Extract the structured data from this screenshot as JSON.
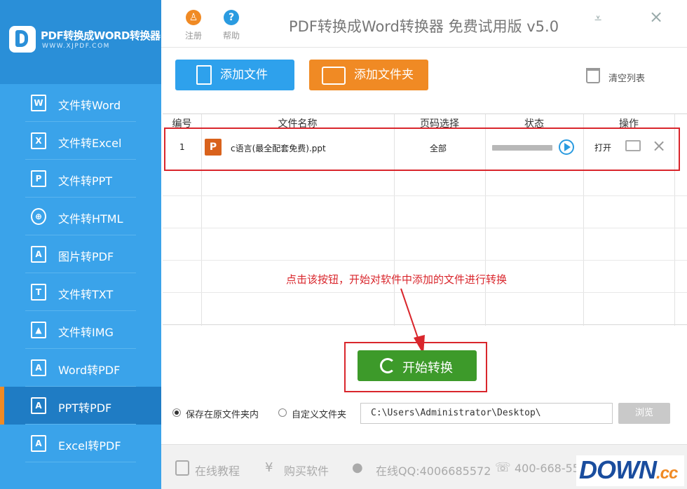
{
  "brand": {
    "title": "PDF转换成WORD转换器",
    "url": "WWW.XJPDF.COM"
  },
  "sidebar": {
    "items": [
      {
        "label": "文件转Word",
        "icon": "word-file-icon",
        "glyph": "W"
      },
      {
        "label": "文件转Excel",
        "icon": "excel-file-icon",
        "glyph": "X"
      },
      {
        "label": "文件转PPT",
        "icon": "ppt-file-icon",
        "glyph": "P"
      },
      {
        "label": "文件转HTML",
        "icon": "globe-icon",
        "glyph": "⊕"
      },
      {
        "label": "图片转PDF",
        "icon": "pdf-file-icon",
        "glyph": "A"
      },
      {
        "label": "文件转TXT",
        "icon": "txt-file-icon",
        "glyph": "T"
      },
      {
        "label": "文件转IMG",
        "icon": "image-icon",
        "glyph": "▲"
      },
      {
        "label": "Word转PDF",
        "icon": "pdf-file-icon",
        "glyph": "A"
      },
      {
        "label": "PPT转PDF",
        "icon": "pdf-file-icon",
        "glyph": "A"
      },
      {
        "label": "Excel转PDF",
        "icon": "pdf-file-icon",
        "glyph": "A"
      }
    ],
    "active_index": 8
  },
  "header": {
    "register_label": "注册",
    "help_label": "帮助",
    "title": "PDF转换成Word转换器 免费试用版 v5.0",
    "minimize": "⩡",
    "close": "×"
  },
  "toolbar": {
    "add_file": "添加文件",
    "add_folder": "添加文件夹",
    "clear_list": "清空列表"
  },
  "table": {
    "columns": [
      "编号",
      "文件名称",
      "页码选择",
      "状态",
      "操作"
    ],
    "rows": [
      {
        "index": "1",
        "filename": "c语言(最全配套免费).ppt",
        "pages": "全部",
        "progress": 0,
        "open": "打开"
      }
    ]
  },
  "annotation": "点击该按钮，开始对软件中添加的文件进行转换",
  "start_button": "开始转换",
  "save": {
    "option_original": "保存在原文件夹内",
    "option_custom": "自定义文件夹",
    "path": "C:\\Users\\Administrator\\Desktop\\",
    "browse": "浏览"
  },
  "footer": {
    "tutorial": "在线教程",
    "buy": "购买软件",
    "qq": "在线QQ:4006685572",
    "phone": "400-668-55"
  },
  "watermark": {
    "main": "DOWN",
    "suffix": ".cc"
  },
  "colors": {
    "sidebar": "#3aa3ea",
    "active": "#1f7cc4",
    "orange": "#f08a24",
    "red": "#d9262c",
    "green": "#3d9a2a"
  }
}
